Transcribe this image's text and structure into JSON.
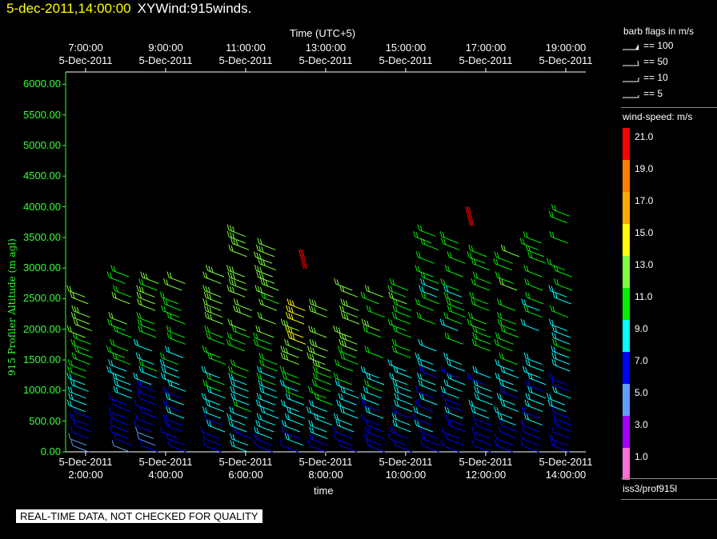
{
  "title": {
    "date": "5-dec-2011,14:00:00",
    "name": "XYWind:915winds."
  },
  "x_top": {
    "label": "Time (UTC+5)",
    "ticks": [
      {
        "time": "7:00:00",
        "date": "5-Dec-2011"
      },
      {
        "time": "9:00:00",
        "date": "5-Dec-2011"
      },
      {
        "time": "11:00:00",
        "date": "5-Dec-2011"
      },
      {
        "time": "13:00:00",
        "date": "5-Dec-2011"
      },
      {
        "time": "15:00:00",
        "date": "5-Dec-2011"
      },
      {
        "time": "17:00:00",
        "date": "5-Dec-2011"
      },
      {
        "time": "19:00:00",
        "date": "5-Dec-2011"
      }
    ]
  },
  "x_bottom": {
    "label": "time",
    "ticks": [
      {
        "date": "5-Dec-2011",
        "time": "2:00:00"
      },
      {
        "date": "5-Dec-2011",
        "time": "4:00:00"
      },
      {
        "date": "5-Dec-2011",
        "time": "6:00:00"
      },
      {
        "date": "5-Dec-2011",
        "time": "8:00:00"
      },
      {
        "date": "5-Dec-2011",
        "time": "10:00:00"
      },
      {
        "date": "5-Dec-2011",
        "time": "12:00:00"
      },
      {
        "date": "5-Dec-2011",
        "time": "14:00:00"
      }
    ]
  },
  "y_axis": {
    "label": "915 Profiler Altitude (m agl)",
    "ticks": [
      "0.00",
      "500.00",
      "1000.00",
      "1500.00",
      "2000.00",
      "2500.00",
      "3000.00",
      "3500.00",
      "4000.00",
      "4500.00",
      "5000.00",
      "5500.00",
      "6000.00"
    ]
  },
  "legend": {
    "flags_title": "barb flags in m/s",
    "flags": [
      "== 100",
      "== 50",
      "== 10",
      "== 5"
    ],
    "speed_title": "wind-speed: m/s",
    "speed_labels": [
      "21.0",
      "19.0",
      "17.0",
      "15.0",
      "13.0",
      "11.0",
      "9.0",
      "7.0",
      "5.0",
      "3.0",
      "1.0"
    ],
    "speed_colors": [
      "#ff0000",
      "#ff7f00",
      "#ffaa00",
      "#ffff00",
      "#7fff3f",
      "#00ee00",
      "#00ffff",
      "#0000ff",
      "#5f9fff",
      "#9f00ff",
      "#ff70d8"
    ],
    "station": "iss3/prof915l"
  },
  "disclaimer": "REAL-TIME DATA, NOT CHECKED FOR QUALITY",
  "chart_data": {
    "type": "scatter",
    "title": "XYWind:915winds.",
    "xlabel": "time",
    "ylabel": "915 Profiler Altitude (m agl)",
    "xlim": [
      "5-Dec-2011 1:30:00",
      "5-Dec-2011 14:30:00"
    ],
    "ylim": [
      0,
      6200
    ],
    "grid": false,
    "profiles": [
      {
        "time": "1:40:00",
        "alt_min": 100,
        "alt_max": 2700,
        "speed_range": [
          6,
          13
        ]
      },
      {
        "time": "2:40:00",
        "alt_min": 100,
        "alt_max": 3000,
        "speed_range": [
          6,
          12
        ]
      },
      {
        "time": "3:20:00",
        "alt_min": 100,
        "alt_max": 2900,
        "speed_range": [
          6,
          12
        ]
      },
      {
        "time": "4:00:00",
        "alt_min": 100,
        "alt_max": 2900,
        "speed_range": [
          6,
          12
        ]
      },
      {
        "time": "5:00:00",
        "alt_min": 100,
        "alt_max": 3000,
        "speed_range": [
          7,
          13
        ]
      },
      {
        "time": "5:40:00",
        "alt_min": 100,
        "alt_max": 3700,
        "speed_range": [
          8,
          13
        ]
      },
      {
        "time": "6:20:00",
        "alt_min": 100,
        "alt_max": 3400,
        "speed_range": [
          8,
          13
        ]
      },
      {
        "time": "7:00:00",
        "alt_min": 100,
        "alt_max": 2500,
        "speed_range": [
          7,
          14
        ]
      },
      {
        "time": "7:40:00",
        "alt_min": 100,
        "alt_max": 2500,
        "speed_range": [
          7,
          14
        ]
      },
      {
        "time": "8:20:00",
        "alt_min": 100,
        "alt_max": 2800,
        "speed_range": [
          7,
          13
        ]
      },
      {
        "time": "9:00:00",
        "alt_min": 100,
        "alt_max": 2700,
        "speed_range": [
          7,
          12
        ]
      },
      {
        "time": "9:40:00",
        "alt_min": 100,
        "alt_max": 2800,
        "speed_range": [
          7,
          12
        ]
      },
      {
        "time": "10:20:00",
        "alt_min": 100,
        "alt_max": 3700,
        "speed_range": [
          7,
          11
        ]
      },
      {
        "time": "11:00:00",
        "alt_min": 100,
        "alt_max": 3600,
        "speed_range": [
          7,
          11
        ]
      },
      {
        "time": "11:40:00",
        "alt_min": 100,
        "alt_max": 3300,
        "speed_range": [
          7,
          11
        ]
      },
      {
        "time": "12:20:00",
        "alt_min": 100,
        "alt_max": 3300,
        "speed_range": [
          7,
          12
        ]
      },
      {
        "time": "13:00:00",
        "alt_min": 100,
        "alt_max": 3600,
        "speed_range": [
          7,
          11
        ]
      },
      {
        "time": "13:40:00",
        "alt_min": 100,
        "alt_max": 4000,
        "speed_range": [
          7,
          11
        ]
      }
    ],
    "isolated_barbs": [
      {
        "time": "7:20:00",
        "alt": 3300,
        "speed": 21
      },
      {
        "time": "11:30:00",
        "alt": 4000,
        "speed": 21
      }
    ]
  }
}
